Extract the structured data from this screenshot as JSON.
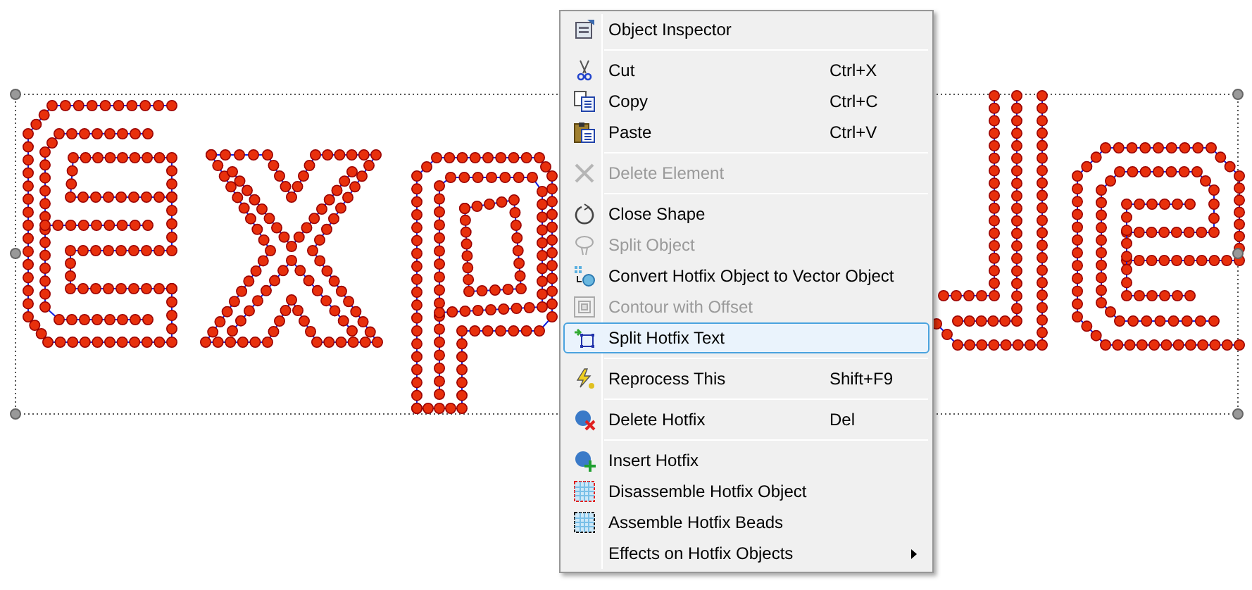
{
  "context_menu": {
    "items": [
      {
        "kind": "item",
        "label": "Object Inspector",
        "disabled": false,
        "selected": false
      },
      {
        "kind": "separator"
      },
      {
        "kind": "item",
        "label": "Cut",
        "shortcut": "Ctrl+X",
        "disabled": false,
        "selected": false
      },
      {
        "kind": "item",
        "label": "Copy",
        "shortcut": "Ctrl+C",
        "disabled": false,
        "selected": false
      },
      {
        "kind": "item",
        "label": "Paste",
        "shortcut": "Ctrl+V",
        "disabled": false,
        "selected": false
      },
      {
        "kind": "separator"
      },
      {
        "kind": "item",
        "label": "Delete Element",
        "disabled": true,
        "selected": false
      },
      {
        "kind": "separator"
      },
      {
        "kind": "item",
        "label": "Close Shape",
        "disabled": false,
        "selected": false
      },
      {
        "kind": "item",
        "label": "Split Object",
        "disabled": true,
        "selected": false
      },
      {
        "kind": "item",
        "label": "Convert Hotfix Object to Vector Object",
        "disabled": false,
        "selected": false
      },
      {
        "kind": "item",
        "label": "Contour with Offset",
        "disabled": true,
        "selected": false
      },
      {
        "kind": "item",
        "label": "Split Hotfix Text",
        "disabled": false,
        "selected": true
      },
      {
        "kind": "separator"
      },
      {
        "kind": "item",
        "label": "Reprocess This",
        "shortcut": "Shift+F9",
        "disabled": false,
        "selected": false
      },
      {
        "kind": "separator"
      },
      {
        "kind": "item",
        "label": "Delete Hotfix",
        "shortcut": "Del",
        "disabled": false,
        "selected": false
      },
      {
        "kind": "separator"
      },
      {
        "kind": "item",
        "label": "Insert Hotfix",
        "disabled": false,
        "selected": false
      },
      {
        "kind": "item",
        "label": "Disassemble Hotfix Object",
        "disabled": false,
        "selected": false
      },
      {
        "kind": "item",
        "label": "Assemble Hotfix Beads",
        "disabled": false,
        "selected": false
      },
      {
        "kind": "item",
        "label": "Effects on Hotfix Objects",
        "disabled": false,
        "selected": false,
        "submenu": true
      }
    ]
  }
}
